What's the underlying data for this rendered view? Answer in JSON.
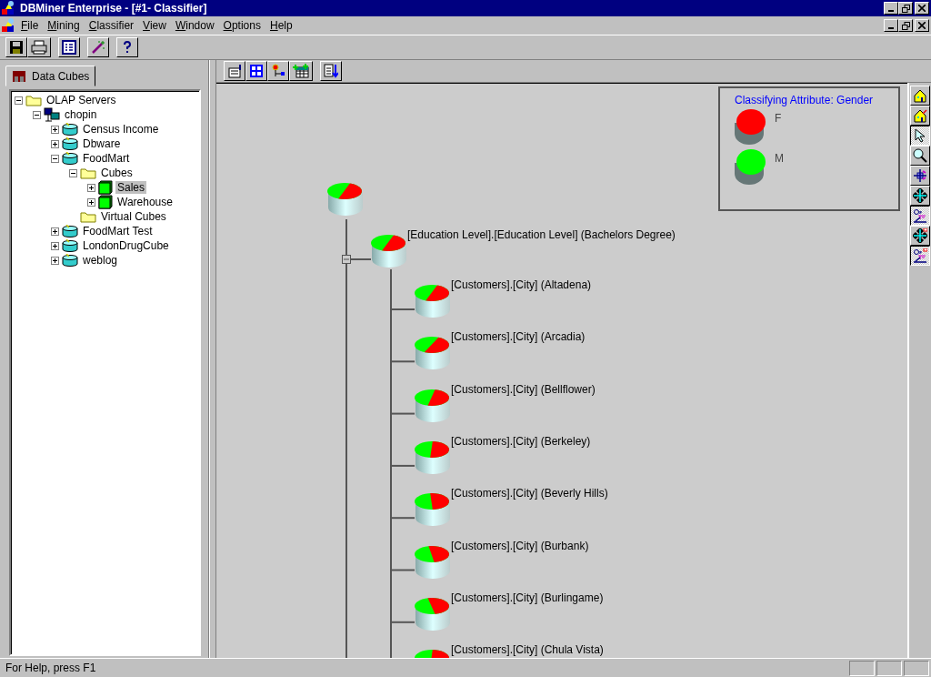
{
  "window": {
    "title": "DBMiner Enterprise - [#1- Classifier]"
  },
  "menu": [
    {
      "label": "File"
    },
    {
      "label": "Mining"
    },
    {
      "label": "Classifier"
    },
    {
      "label": "View"
    },
    {
      "label": "Window"
    },
    {
      "label": "Options"
    },
    {
      "label": "Help"
    }
  ],
  "left_tab": {
    "label": "Data Cubes",
    "selected": true
  },
  "tree": [
    {
      "label": "OLAP Servers",
      "kind": "folder",
      "expanded": true,
      "selected": false,
      "children": [
        {
          "label": "chopin",
          "kind": "server",
          "expanded": true,
          "selected": false,
          "children": [
            {
              "label": "Census Income",
              "kind": "database",
              "expanded": false,
              "selected": false
            },
            {
              "label": "Dbware",
              "kind": "database",
              "expanded": false,
              "selected": false
            },
            {
              "label": "FoodMart",
              "kind": "database",
              "expanded": true,
              "selected": false,
              "children": [
                {
                  "label": "Cubes",
                  "kind": "folder",
                  "expanded": true,
                  "selected": false,
                  "children": [
                    {
                      "label": "Sales",
                      "kind": "cube",
                      "expanded": false,
                      "selected": true
                    },
                    {
                      "label": "Warehouse",
                      "kind": "cube",
                      "expanded": false,
                      "selected": false
                    }
                  ]
                },
                {
                  "label": "Virtual Cubes",
                  "kind": "folder",
                  "selected": false
                }
              ]
            },
            {
              "label": "FoodMart Test",
              "kind": "database",
              "expanded": false,
              "selected": false
            },
            {
              "label": "LondonDrugCube",
              "kind": "database",
              "expanded": false,
              "selected": false
            },
            {
              "label": "weblog",
              "kind": "database",
              "expanded": false,
              "selected": false
            }
          ]
        }
      ]
    }
  ],
  "diagram": {
    "branch": {
      "label": "[Education Level].[Education Level] (Bachelors Degree)",
      "expanded": true
    },
    "leaves": [
      {
        "label": "[Customers].[City] (Altadena)"
      },
      {
        "label": "[Customers].[City] (Arcadia)"
      },
      {
        "label": "[Customers].[City] (Bellflower)"
      },
      {
        "label": "[Customers].[City] (Berkeley)"
      },
      {
        "label": "[Customers].[City] (Beverly Hills)"
      },
      {
        "label": "[Customers].[City] (Burbank)"
      },
      {
        "label": "[Customers].[City] (Burlingame)"
      },
      {
        "label": "[Customers].[City] (Chula Vista)"
      }
    ]
  },
  "legend": {
    "title": "Classifying Attribute: Gender",
    "classes": [
      {
        "label": "F",
        "color": "#ff0000"
      },
      {
        "label": "M",
        "color": "#00ff00"
      }
    ]
  },
  "tools": [
    {
      "kind": "home",
      "pressed": false
    },
    {
      "kind": "home-arrow",
      "pressed": false
    },
    {
      "kind": "pointer",
      "pressed": true
    },
    {
      "kind": "zoom",
      "pressed": false
    },
    {
      "kind": "rotate",
      "pressed": false
    },
    {
      "kind": "move",
      "pressed": false
    },
    {
      "kind": "onoff",
      "pressed": true
    },
    {
      "kind": "move-mark",
      "pressed": false
    },
    {
      "kind": "onoff-mark",
      "pressed": true
    }
  ],
  "status_bar": {
    "text": "For Help, press F1"
  }
}
